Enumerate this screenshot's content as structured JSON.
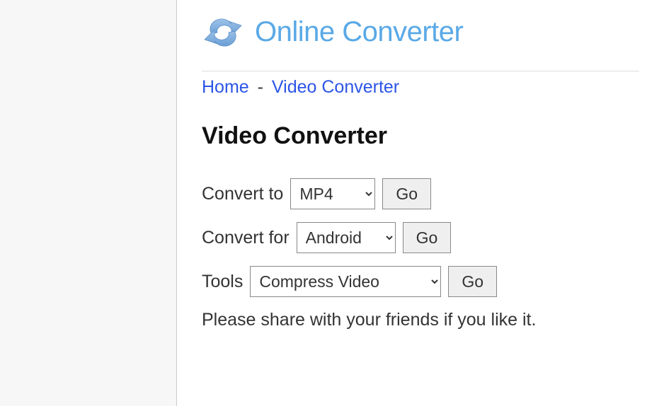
{
  "header": {
    "site_title": "Online Converter"
  },
  "breadcrumb": {
    "home_label": "Home",
    "separator": "-",
    "current_label": "Video Converter"
  },
  "page": {
    "heading": "Video Converter",
    "share_prompt": "Please share with your friends if you like it."
  },
  "forms": {
    "convert_to": {
      "label": "Convert to",
      "selected": "MP4",
      "go_label": "Go"
    },
    "convert_for": {
      "label": "Convert for",
      "selected": "Android",
      "go_label": "Go"
    },
    "tools": {
      "label": "Tools",
      "selected": "Compress Video",
      "go_label": "Go"
    }
  }
}
